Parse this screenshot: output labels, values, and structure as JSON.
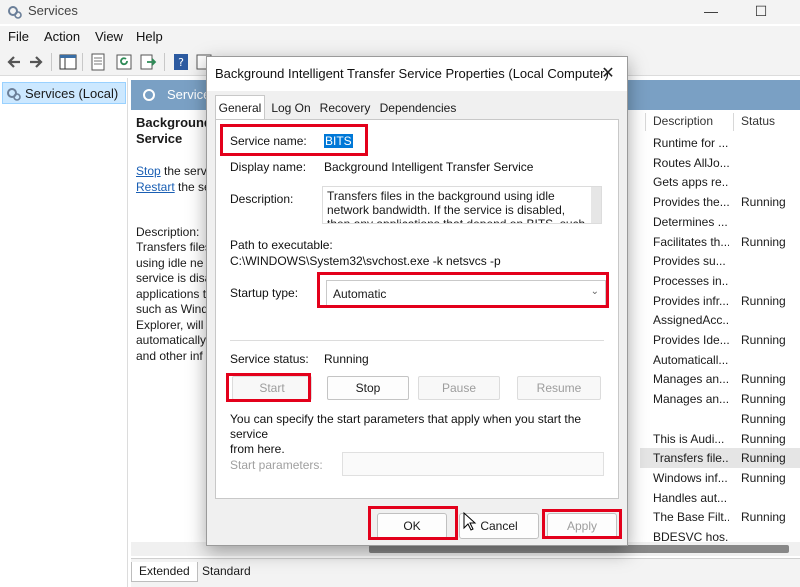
{
  "window": {
    "title": "Services"
  },
  "menu": [
    "File",
    "Action",
    "View",
    "Help"
  ],
  "tree": {
    "root_label": "Services (Local)"
  },
  "panel": {
    "header": "Services"
  },
  "detail": {
    "title_line1": "Background",
    "title_line2": "Service",
    "stop_link": "Stop",
    "stop_suffix": " the serv",
    "restart_link": "Restart",
    "restart_suffix": " the se",
    "description_label": "Description:",
    "description_text": "Transfers files\nusing idle ne\nservice is disa\napplications t\nsuch as Wind\nExplorer, will\nautomatically\nand other inf"
  },
  "list": {
    "columns": [
      "Description",
      "Status"
    ],
    "rows": [
      {
        "description": "Runtime for ...",
        "status": ""
      },
      {
        "description": "Routes AllJo...",
        "status": ""
      },
      {
        "description": "Gets apps re...",
        "status": ""
      },
      {
        "description": "Provides the...",
        "status": "Running"
      },
      {
        "description": "Determines ...",
        "status": ""
      },
      {
        "description": "Facilitates th...",
        "status": "Running"
      },
      {
        "description": "Provides su...",
        "status": ""
      },
      {
        "description": "Processes in...",
        "status": ""
      },
      {
        "description": "Provides infr...",
        "status": "Running"
      },
      {
        "description": "AssignedAcc...",
        "status": ""
      },
      {
        "description": "Provides Ide...",
        "status": "Running"
      },
      {
        "description": "Automaticall...",
        "status": ""
      },
      {
        "description": "Manages an...",
        "status": "Running"
      },
      {
        "description": "Manages an...",
        "status": "Running"
      },
      {
        "description": "",
        "status": "Running"
      },
      {
        "description": "This is Audi...",
        "status": "Running"
      },
      {
        "description": "Transfers file...",
        "status": "Running"
      },
      {
        "description": "Windows inf...",
        "status": "Running"
      },
      {
        "description": "Handles aut...",
        "status": ""
      },
      {
        "description": "The Base Filt...",
        "status": "Running"
      },
      {
        "description": "BDESVC hos...",
        "status": ""
      }
    ],
    "selected_index": 16
  },
  "bottom_tabs": [
    "Extended",
    "Standard"
  ],
  "dialog": {
    "title": "Background Intelligent Transfer Service Properties (Local Computer)",
    "close_glyph": "✕",
    "tabs": [
      "General",
      "Log On",
      "Recovery",
      "Dependencies"
    ],
    "service_name_label": "Service name:",
    "service_name_value": "BITS",
    "display_name_label": "Display name:",
    "display_name_value": "Background Intelligent Transfer Service",
    "description_label": "Description:",
    "description_value": "Transfers files in the background using idle network bandwidth. If the service is disabled, then any applications that depend on BITS, such as Windows",
    "path_label": "Path to executable:",
    "path_value": "C:\\WINDOWS\\System32\\svchost.exe -k netsvcs -p",
    "startup_label": "Startup type:",
    "startup_value": "Automatic",
    "status_label": "Service status:",
    "status_value": "Running",
    "buttons": {
      "start": "Start",
      "stop": "Stop",
      "pause": "Pause",
      "resume": "Resume"
    },
    "hint": "You can specify the start parameters that apply when you start the service\nfrom here.",
    "params_label": "Start parameters:",
    "params_value": "",
    "footer": {
      "ok": "OK",
      "cancel": "Cancel",
      "apply": "Apply"
    }
  },
  "colors": {
    "highlight": "#e3001b",
    "selection": "#0078d7",
    "panel_header": "#7aa0c4"
  }
}
